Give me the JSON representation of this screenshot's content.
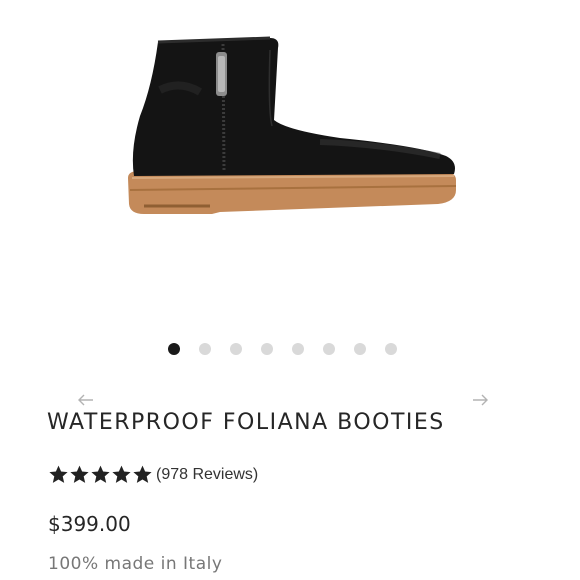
{
  "product": {
    "title": "WATERPROOF FOLIANA BOOTIES",
    "rating_value": 5,
    "rating_max": 5,
    "reviews_label": "(978 Reviews)",
    "price": "$399.00",
    "origin": "100% made in Italy"
  },
  "carousel": {
    "total_slides": 8,
    "active_index": 0
  },
  "colors": {
    "boot": "#141414",
    "sole": "#c48a5a",
    "dot_active": "#1a1a1a",
    "dot_inactive": "#d9d9d9",
    "star": "#222222"
  }
}
